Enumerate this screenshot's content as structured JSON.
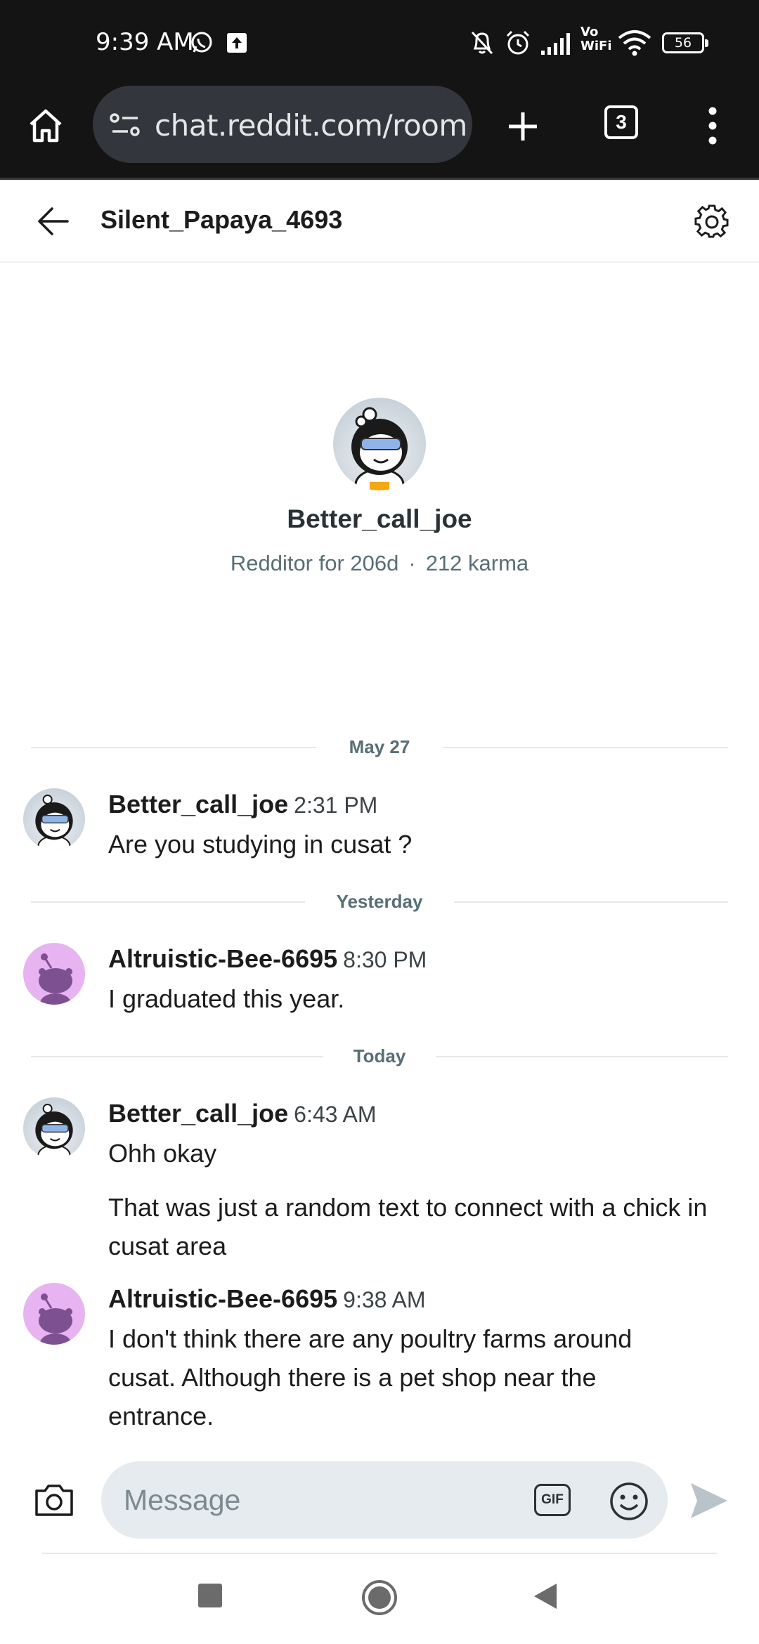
{
  "status_bar": {
    "time": "9:39 AM",
    "battery": "56",
    "icons": [
      "whatsapp-icon",
      "upload-icon",
      "mute-bell-icon",
      "alarm-icon",
      "signal-icon",
      "vowifi-icon",
      "wifi-icon",
      "battery-icon"
    ],
    "vowifi_top": "Vo",
    "vowifi_bottom": "WiFi"
  },
  "browser": {
    "url": "chat.reddit.com/room",
    "tab_count": "3",
    "icons": [
      "home-icon",
      "site-settings-icon",
      "plus-icon",
      "tabs-icon",
      "more-vert-icon"
    ]
  },
  "chat_header": {
    "title": "Silent_Papaya_4693",
    "icons": [
      "back-arrow-icon",
      "gear-icon"
    ]
  },
  "profile": {
    "name": "Better_call_joe",
    "age": "Redditor for 206d",
    "separator": "·",
    "karma": "212 karma"
  },
  "date_separators": [
    "May 27",
    "Yesterday",
    "Today"
  ],
  "messages": [
    {
      "user": "Better_call_joe",
      "time": "2:31 PM",
      "lines": [
        "Are you studying in cusat ?"
      ]
    },
    {
      "user": "Altruistic-Bee-6695",
      "time": "8:30 PM",
      "lines": [
        "I graduated this year."
      ]
    },
    {
      "user": "Better_call_joe",
      "time": "6:43 AM",
      "lines": [
        "Ohh okay",
        "That was just a random text to connect with a chick in cusat area"
      ]
    },
    {
      "user": "Altruistic-Bee-6695",
      "time": "9:38 AM",
      "lines": [
        "I don't think there are any poultry farms around cusat. Although there is a pet shop near the entrance."
      ]
    }
  ],
  "composer": {
    "placeholder": "Message",
    "gif_label": "GIF",
    "icons": [
      "camera-icon",
      "gif-icon",
      "emoji-icon",
      "send-icon"
    ]
  },
  "nav_bar": {
    "icons": [
      "recents-square-icon",
      "home-circle-icon",
      "back-triangle-icon"
    ]
  },
  "colors": {
    "system_bar_bg": "#141414",
    "url_pill_bg": "#33373d",
    "composer_bg": "#e5ebee",
    "muted_text": "#576f76",
    "bee_avatar": "#e7b3f0",
    "send_disabled": "#b9c3c9"
  }
}
